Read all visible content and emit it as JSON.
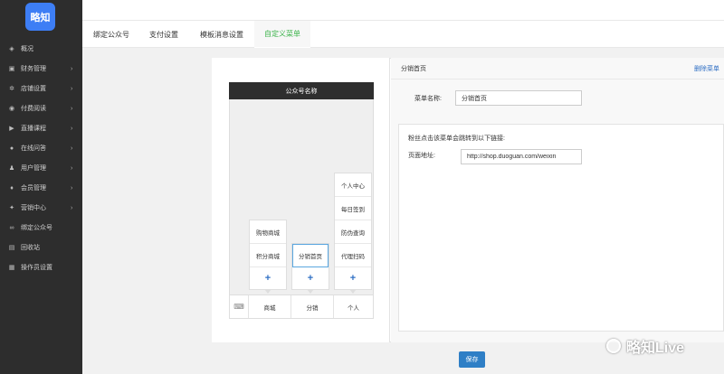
{
  "brand": {
    "logo_text": "略知"
  },
  "colors": {
    "sidebar": "#2d2d2d",
    "accent": "#3bb34a",
    "primary": "#2f7fc6",
    "logo": "#3d7ef5"
  },
  "sidebar": {
    "items": [
      {
        "label": "概况",
        "icon": "layers-icon",
        "arrow": ""
      },
      {
        "label": "财务管理",
        "icon": "finance-icon",
        "arrow": "›"
      },
      {
        "label": "店铺设置",
        "icon": "gear-icon",
        "arrow": "›"
      },
      {
        "label": "付费阅读",
        "icon": "eye-icon",
        "arrow": "›"
      },
      {
        "label": "直播课程",
        "icon": "video-icon",
        "arrow": "›"
      },
      {
        "label": "在线问答",
        "icon": "location-icon",
        "arrow": "›"
      },
      {
        "label": "用户管理",
        "icon": "user-icon",
        "arrow": "›"
      },
      {
        "label": "会员管理",
        "icon": "member-icon",
        "arrow": "›"
      },
      {
        "label": "营销中心",
        "icon": "marketing-icon",
        "arrow": "›"
      },
      {
        "label": "绑定公众号",
        "icon": "link-icon",
        "arrow": ""
      },
      {
        "label": "回收站",
        "icon": "trash-icon",
        "arrow": ""
      },
      {
        "label": "操作员设置",
        "icon": "operator-icon",
        "arrow": ""
      }
    ]
  },
  "tabs": [
    "绑定公众号",
    "支付设置",
    "模板消息设置",
    "自定义菜单"
  ],
  "active_tab": "自定义菜单",
  "phone": {
    "title": "公众号名称",
    "menus": [
      {
        "label": "商城",
        "sub": [
          "购物商城",
          "积分商城"
        ],
        "add": "+"
      },
      {
        "label": "分销",
        "sub": [
          "分销首页"
        ],
        "add": "+"
      },
      {
        "label": "个人",
        "sub": [
          "个人中心",
          "每日签到",
          "防伪查询",
          "代理扫码"
        ],
        "add": "+"
      }
    ]
  },
  "editor": {
    "title": "分销首页",
    "delete_label": "删除菜单",
    "name_label": "菜单名称:",
    "name_value": "分销首页",
    "hint": "粉丝点击该菜单会跳转到以下链接:",
    "url_label": "页面地址:",
    "url_value": "http://shop.duoguan.com/weixin"
  },
  "save_label": "保存",
  "watermark": "略知Live"
}
